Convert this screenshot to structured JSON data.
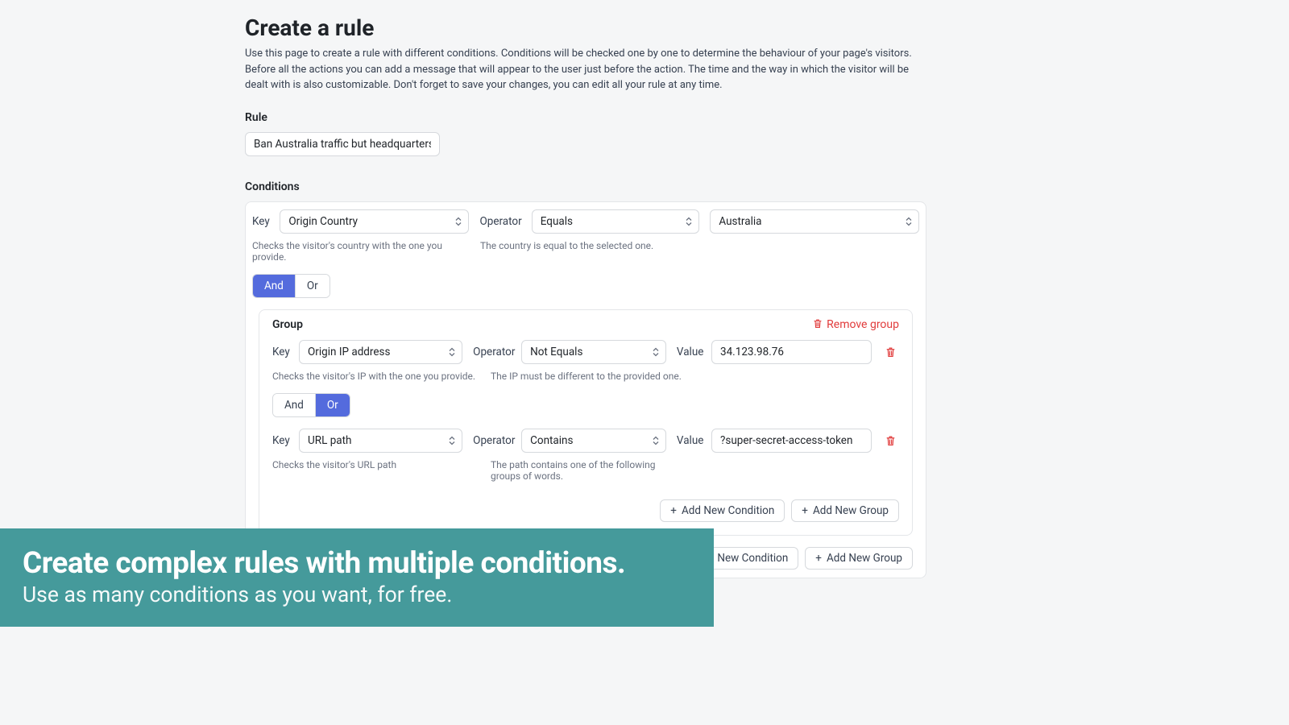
{
  "title": "Create a rule",
  "description": "Use this page to create a rule with different conditions. Conditions will be checked one by one to determine the behaviour of your page's visitors. Before all the actions you can add a message that will appear to the user just before the action. The time and the way in which the visitor will be dealt with is also customizable. Don't forget to save your changes, you can edit all your rule at any time.",
  "rule_label": "Rule",
  "rule_value": "Ban Australia traffic but headquarters",
  "conditions_label": "Conditions",
  "labels": {
    "key": "Key",
    "operator": "Operator",
    "value": "Value",
    "and": "And",
    "or": "Or",
    "group": "Group",
    "remove_group": "Remove group",
    "add_condition": "Add New Condition",
    "add_group": "Add New Group"
  },
  "cond1": {
    "key": "Origin Country",
    "operator": "Equals",
    "value": "Australia",
    "key_hint": "Checks the visitor's country with the one you provide.",
    "op_hint": "The country is equal to the selected one."
  },
  "cond2": {
    "key": "Origin IP address",
    "operator": "Not Equals",
    "value": "34.123.98.76",
    "key_hint": "Checks the visitor's IP with the one you provide.",
    "op_hint": "The IP must be different to the provided one."
  },
  "cond3": {
    "key": "URL path",
    "operator": "Contains",
    "value": "?super-secret-access-token",
    "key_hint": "Checks the visitor's URL path",
    "op_hint": "The path contains one of the following groups of words."
  },
  "overlay": {
    "headline": "Create complex rules with multiple conditions.",
    "sub": "Use as many conditions as you want, for free."
  }
}
